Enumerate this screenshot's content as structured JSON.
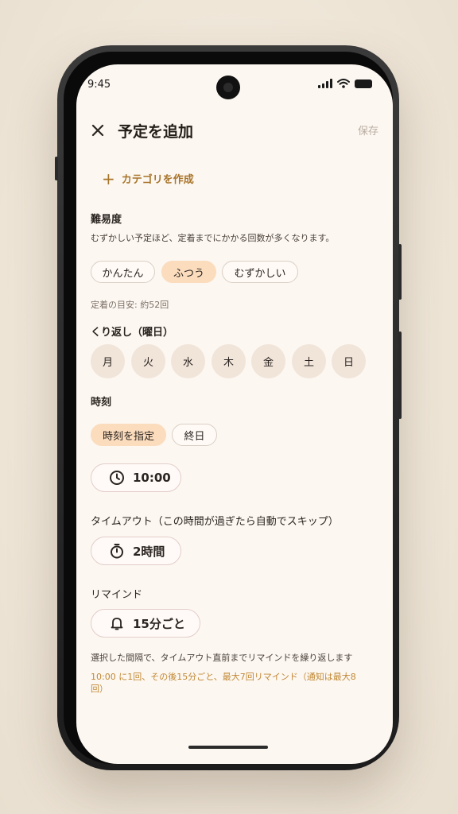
{
  "status": {
    "time": "9:45"
  },
  "header": {
    "title": "予定を追加",
    "save_label": "保存"
  },
  "create_category": {
    "label": "カテゴリを作成"
  },
  "difficulty": {
    "label": "難易度",
    "description": "むずかしい予定ほど、定着までにかかる回数が多くなります。",
    "options": [
      "かんたん",
      "ふつう",
      "むずかしい"
    ],
    "selected": "ふつう",
    "hint": "定着の目安: 約52回"
  },
  "repeat": {
    "label": "くり返し（曜日）",
    "days": [
      "月",
      "火",
      "水",
      "木",
      "金",
      "土",
      "日"
    ]
  },
  "time": {
    "label": "時刻",
    "options": [
      "時刻を指定",
      "終日"
    ],
    "selected": "時刻を指定",
    "value": "10:00"
  },
  "timeout": {
    "label": "タイムアウト（この時間が過ぎたら自動でスキップ）",
    "value": "2時間"
  },
  "remind": {
    "label": "リマインド",
    "value": "15分ごと",
    "description": "選択した間隔で、タイムアウト直前までリマインドを繰り返します",
    "note": "10:00 に1回、その後15分ごと、最大7回リマインド（通知は最大8回）"
  },
  "colors": {
    "accent": "#a8742a",
    "chip_selected": "#fbdcbd",
    "note": "#c28834",
    "background": "#fcf7f1"
  }
}
